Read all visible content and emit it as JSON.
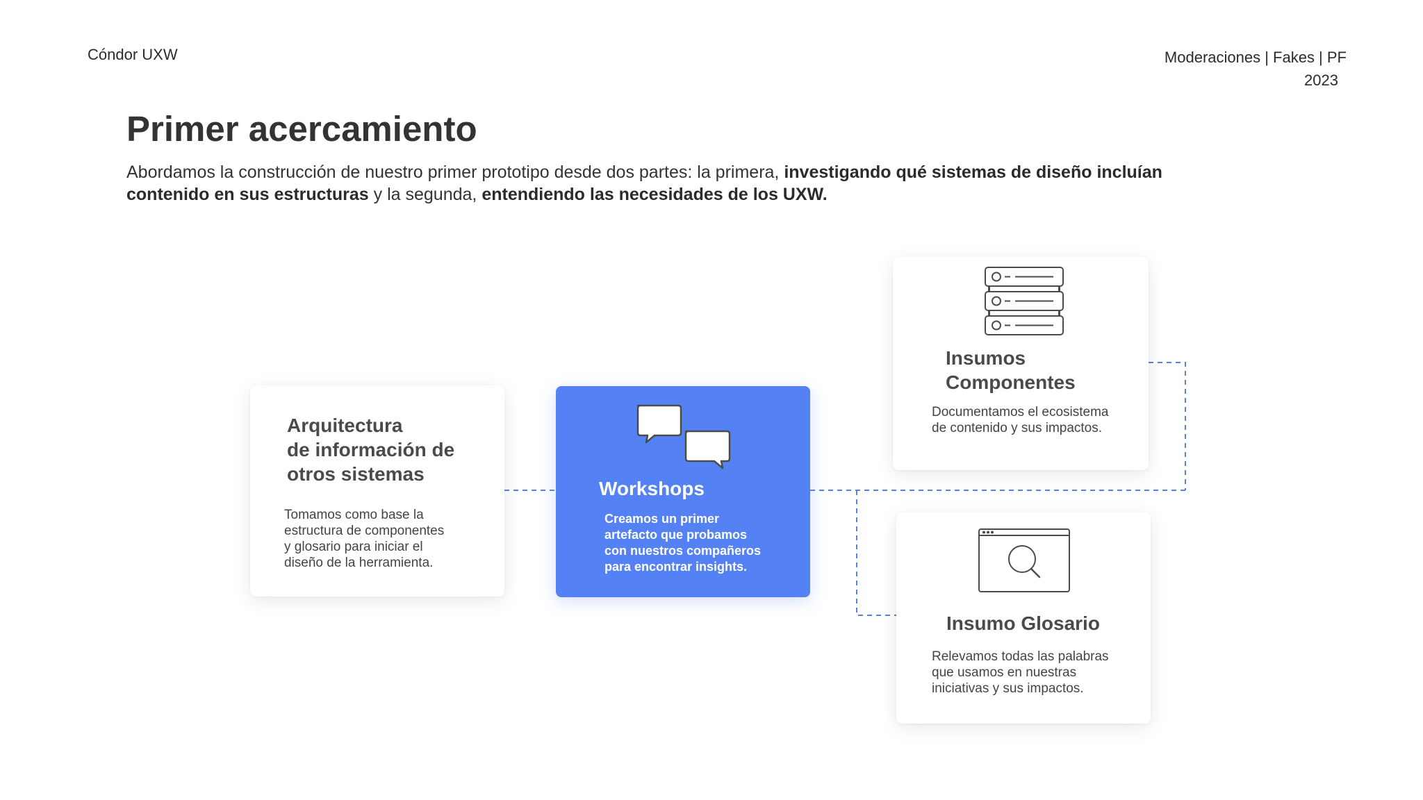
{
  "header": {
    "brand": "Cóndor UXW",
    "meta_line1": "Moderaciones | Fakes | PF",
    "meta_line2": "2023"
  },
  "title": "Primer acercamiento",
  "intro": {
    "part1": "Abordamos la construcción de nuestro primer prototipo desde dos partes: la primera, ",
    "bold1": "investigando qué sistemas de diseño incluían contenido en sus estructuras",
    "part2": " y la segunda, ",
    "bold2": "entendiendo las necesidades de los UXW."
  },
  "cards": {
    "arquitectura": {
      "title": "Arquitectura\nde información de\notros sistemas",
      "desc": "Tomamos como base la\nestructura de componentes\ny glosario para iniciar el\ndiseño de la herramienta."
    },
    "workshops": {
      "title": "Workshops",
      "desc": "Creamos un primer\nartefacto que probamos\ncon nuestros compañeros\npara encontrar insights."
    },
    "componentes": {
      "title": "Insumos\nComponentes",
      "desc": "Documentamos el ecosistema\nde contenido y sus impactos."
    },
    "glosario": {
      "title": "Insumo Glosario",
      "desc": "Relevamos todas las palabras\nque usamos en nuestras\niniciativas y sus impactos."
    }
  },
  "icons": {
    "workshops": "chat-bubbles-icon",
    "componentes": "server-stack-icon",
    "glosario": "browser-search-icon"
  },
  "colors": {
    "accent": "#5482f4",
    "connector": "#5b82d6",
    "text": "#333333"
  }
}
